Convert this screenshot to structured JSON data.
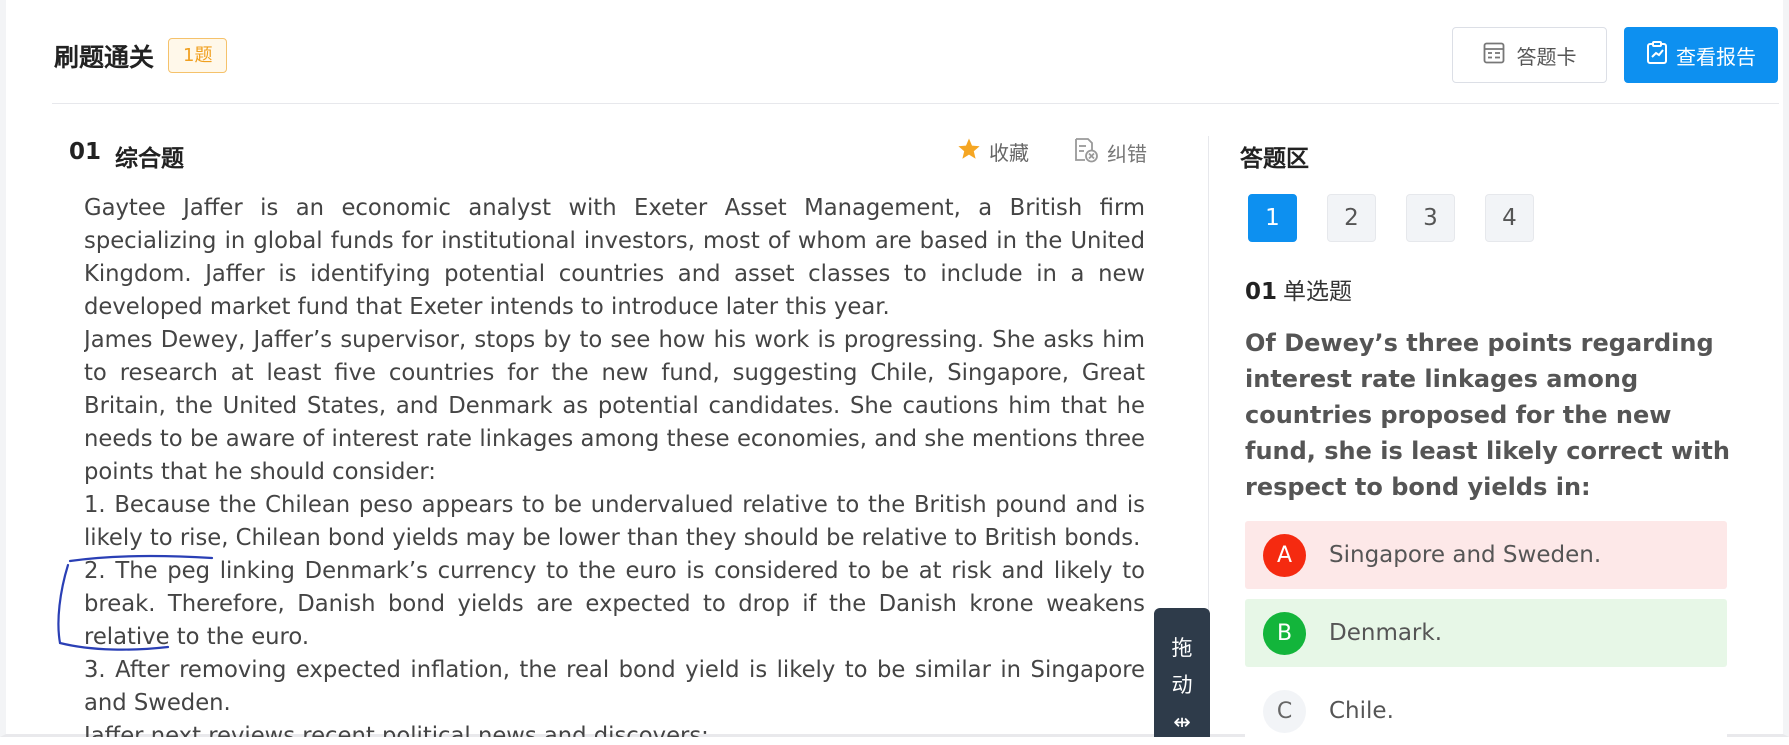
{
  "header": {
    "title": "刷题通关",
    "count_badge": "1题",
    "answer_card_label": "答题卡",
    "view_report_label": "查看报告"
  },
  "question": {
    "number": "01",
    "type": "综合题",
    "favorite_label": "收藏",
    "report_error_label": "纠错",
    "passage": [
      "Gaytee Jaffer is an economic analyst with Exeter Asset Management, a British firm specializing in global funds for institutional investors, most of whom are based in the United Kingdom. Jaffer is identifying potential countries and asset classes to include in a new developed market fund that Exeter intends to introduce later this year.",
      "James Dewey, Jaffer’s supervisor, stops by to see how his work is progressing. She asks him to research at least five countries for the new fund, suggesting Chile, Singapore, Great Britain, the United States, and Denmark as potential candidates. She cautions him that he needs to be aware of interest rate linkages among these economies, and she mentions three points that he should consider:",
      "1. Because the Chilean peso appears to be undervalued relative to the British pound and is likely to rise, Chilean bond yields may be lower than they should be relative to British bonds.",
      "2. The peg linking Denmark’s currency to the euro is considered to be at risk and likely to break. Therefore, Danish bond yields are expected to drop if the Danish krone weakens relative to the euro.",
      "3. After removing expected inflation, the real bond yield is likely to be similar in Singapore and Sweden.",
      "Jaffer next reviews recent political news and discovers:"
    ],
    "drag_label_1": "拖",
    "drag_label_2": "动",
    "drag_icon": "⇹"
  },
  "answer_area": {
    "title": "答题区",
    "tabs": [
      "1",
      "2",
      "3",
      "4"
    ],
    "active_tab": "1",
    "sub_number": "01",
    "sub_type": "单选题",
    "stem": "Of Dewey’s three points regarding interest rate linkages among countries proposed for the new fund, she is least likely correct with respect to bond yields in:",
    "options": [
      {
        "letter": "A",
        "text": "Singapore and Sweden.",
        "state": "incorrect",
        "color": "#f52a10"
      },
      {
        "letter": "B",
        "text": "Denmark.",
        "state": "correct",
        "color": "#13b53b"
      },
      {
        "letter": "C",
        "text": "Chile.",
        "state": "default"
      }
    ]
  },
  "colors": {
    "primary": "#0d90f0",
    "badge_orange": "#f0a020",
    "incorrect_bg": "#fde8e8",
    "correct_bg": "#e7f7e7",
    "star": "#f5a623",
    "drag_bg": "#2e3b4a"
  }
}
